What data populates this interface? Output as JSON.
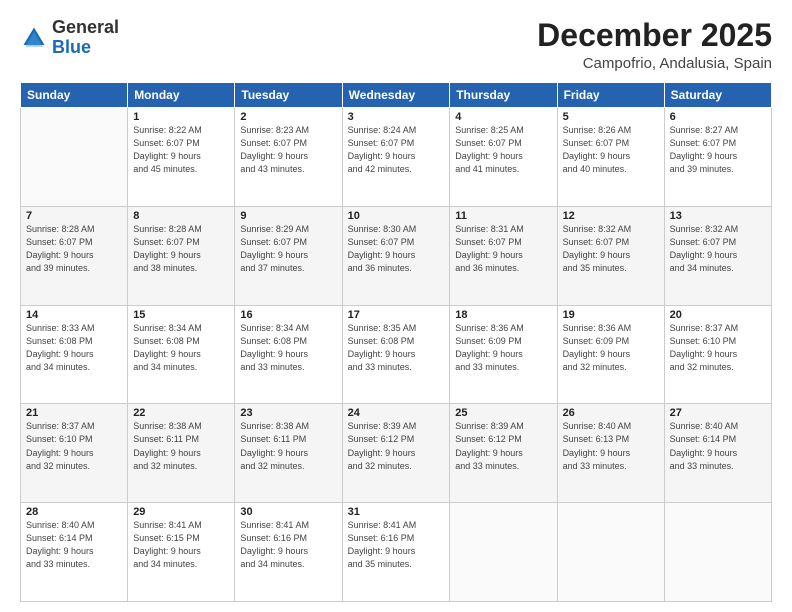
{
  "header": {
    "logo_general": "General",
    "logo_blue": "Blue",
    "main_title": "December 2025",
    "subtitle": "Campofrio, Andalusia, Spain"
  },
  "days_of_week": [
    "Sunday",
    "Monday",
    "Tuesday",
    "Wednesday",
    "Thursday",
    "Friday",
    "Saturday"
  ],
  "weeks": [
    [
      {
        "day": "",
        "info": ""
      },
      {
        "day": "1",
        "info": "Sunrise: 8:22 AM\nSunset: 6:07 PM\nDaylight: 9 hours\nand 45 minutes."
      },
      {
        "day": "2",
        "info": "Sunrise: 8:23 AM\nSunset: 6:07 PM\nDaylight: 9 hours\nand 43 minutes."
      },
      {
        "day": "3",
        "info": "Sunrise: 8:24 AM\nSunset: 6:07 PM\nDaylight: 9 hours\nand 42 minutes."
      },
      {
        "day": "4",
        "info": "Sunrise: 8:25 AM\nSunset: 6:07 PM\nDaylight: 9 hours\nand 41 minutes."
      },
      {
        "day": "5",
        "info": "Sunrise: 8:26 AM\nSunset: 6:07 PM\nDaylight: 9 hours\nand 40 minutes."
      },
      {
        "day": "6",
        "info": "Sunrise: 8:27 AM\nSunset: 6:07 PM\nDaylight: 9 hours\nand 39 minutes."
      }
    ],
    [
      {
        "day": "7",
        "info": "Sunrise: 8:28 AM\nSunset: 6:07 PM\nDaylight: 9 hours\nand 39 minutes."
      },
      {
        "day": "8",
        "info": "Sunrise: 8:28 AM\nSunset: 6:07 PM\nDaylight: 9 hours\nand 38 minutes."
      },
      {
        "day": "9",
        "info": "Sunrise: 8:29 AM\nSunset: 6:07 PM\nDaylight: 9 hours\nand 37 minutes."
      },
      {
        "day": "10",
        "info": "Sunrise: 8:30 AM\nSunset: 6:07 PM\nDaylight: 9 hours\nand 36 minutes."
      },
      {
        "day": "11",
        "info": "Sunrise: 8:31 AM\nSunset: 6:07 PM\nDaylight: 9 hours\nand 36 minutes."
      },
      {
        "day": "12",
        "info": "Sunrise: 8:32 AM\nSunset: 6:07 PM\nDaylight: 9 hours\nand 35 minutes."
      },
      {
        "day": "13",
        "info": "Sunrise: 8:32 AM\nSunset: 6:07 PM\nDaylight: 9 hours\nand 34 minutes."
      }
    ],
    [
      {
        "day": "14",
        "info": "Sunrise: 8:33 AM\nSunset: 6:08 PM\nDaylight: 9 hours\nand 34 minutes."
      },
      {
        "day": "15",
        "info": "Sunrise: 8:34 AM\nSunset: 6:08 PM\nDaylight: 9 hours\nand 34 minutes."
      },
      {
        "day": "16",
        "info": "Sunrise: 8:34 AM\nSunset: 6:08 PM\nDaylight: 9 hours\nand 33 minutes."
      },
      {
        "day": "17",
        "info": "Sunrise: 8:35 AM\nSunset: 6:08 PM\nDaylight: 9 hours\nand 33 minutes."
      },
      {
        "day": "18",
        "info": "Sunrise: 8:36 AM\nSunset: 6:09 PM\nDaylight: 9 hours\nand 33 minutes."
      },
      {
        "day": "19",
        "info": "Sunrise: 8:36 AM\nSunset: 6:09 PM\nDaylight: 9 hours\nand 32 minutes."
      },
      {
        "day": "20",
        "info": "Sunrise: 8:37 AM\nSunset: 6:10 PM\nDaylight: 9 hours\nand 32 minutes."
      }
    ],
    [
      {
        "day": "21",
        "info": "Sunrise: 8:37 AM\nSunset: 6:10 PM\nDaylight: 9 hours\nand 32 minutes."
      },
      {
        "day": "22",
        "info": "Sunrise: 8:38 AM\nSunset: 6:11 PM\nDaylight: 9 hours\nand 32 minutes."
      },
      {
        "day": "23",
        "info": "Sunrise: 8:38 AM\nSunset: 6:11 PM\nDaylight: 9 hours\nand 32 minutes."
      },
      {
        "day": "24",
        "info": "Sunrise: 8:39 AM\nSunset: 6:12 PM\nDaylight: 9 hours\nand 32 minutes."
      },
      {
        "day": "25",
        "info": "Sunrise: 8:39 AM\nSunset: 6:12 PM\nDaylight: 9 hours\nand 33 minutes."
      },
      {
        "day": "26",
        "info": "Sunrise: 8:40 AM\nSunset: 6:13 PM\nDaylight: 9 hours\nand 33 minutes."
      },
      {
        "day": "27",
        "info": "Sunrise: 8:40 AM\nSunset: 6:14 PM\nDaylight: 9 hours\nand 33 minutes."
      }
    ],
    [
      {
        "day": "28",
        "info": "Sunrise: 8:40 AM\nSunset: 6:14 PM\nDaylight: 9 hours\nand 33 minutes."
      },
      {
        "day": "29",
        "info": "Sunrise: 8:41 AM\nSunset: 6:15 PM\nDaylight: 9 hours\nand 34 minutes."
      },
      {
        "day": "30",
        "info": "Sunrise: 8:41 AM\nSunset: 6:16 PM\nDaylight: 9 hours\nand 34 minutes."
      },
      {
        "day": "31",
        "info": "Sunrise: 8:41 AM\nSunset: 6:16 PM\nDaylight: 9 hours\nand 35 minutes."
      },
      {
        "day": "",
        "info": ""
      },
      {
        "day": "",
        "info": ""
      },
      {
        "day": "",
        "info": ""
      }
    ]
  ]
}
